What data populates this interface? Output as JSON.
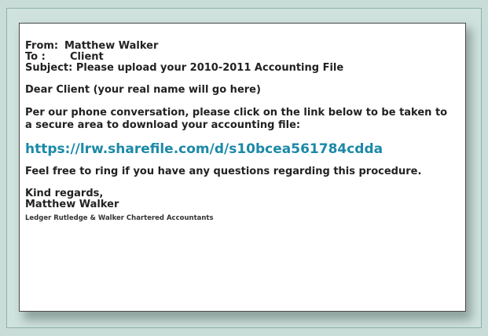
{
  "email": {
    "from_label": "From:",
    "from_value": "Matthew Walker",
    "to_label": "To :",
    "to_value": "Client",
    "subject": "Subject: Please upload your 2010-2011 Accounting File",
    "greeting": "Dear Client (your real name will go here)",
    "body_intro": "Per our phone conversation, please click on the link below to be taken to a secure area to download your accounting file:",
    "link": "https://lrw.sharefile.com/d/s10bcea561784cdda",
    "body_outro": "Feel free to ring if you have any questions regarding this procedure.",
    "closing": "Kind regards,",
    "signature_name": "Matthew Walker",
    "signature_company": "Ledger Rutledge & Walker Chartered Accountants"
  },
  "colors": {
    "link": "#1c89a8",
    "background": "#c9dcd8"
  }
}
